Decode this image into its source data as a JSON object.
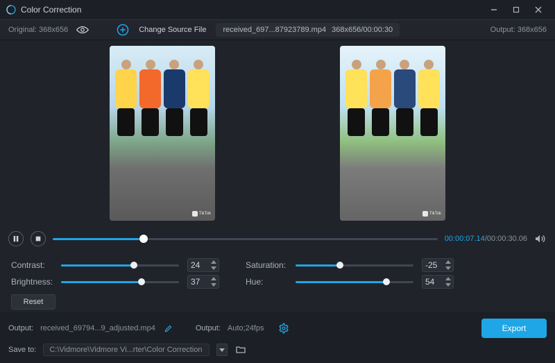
{
  "title": "Color Correction",
  "top": {
    "original_label": "Original: 368x656",
    "change_source": "Change Source File",
    "filename": "received_697...87923789.mp4",
    "fileinfo": "368x656/00:00:30",
    "output_label": "Output: 368x656"
  },
  "playback": {
    "current": "00:00:07.14",
    "total": "00:00:30.06"
  },
  "sliders": {
    "contrast": {
      "label": "Contrast:",
      "value": "24",
      "pct": 62
    },
    "saturation": {
      "label": "Saturation:",
      "value": "-25",
      "pct": 37.5
    },
    "brightness": {
      "label": "Brightness:",
      "value": "37",
      "pct": 68.5
    },
    "hue": {
      "label": "Hue:",
      "value": "54",
      "pct": 77
    }
  },
  "reset_label": "Reset",
  "output": {
    "file_key": "Output:",
    "file_val": "received_69794...9_adjusted.mp4",
    "fmt_key": "Output:",
    "fmt_val": "Auto;24fps",
    "save_key": "Save to:",
    "save_val": "C:\\Vidmore\\Vidmore Vi...rter\\Color Correction"
  },
  "export_label": "Export"
}
